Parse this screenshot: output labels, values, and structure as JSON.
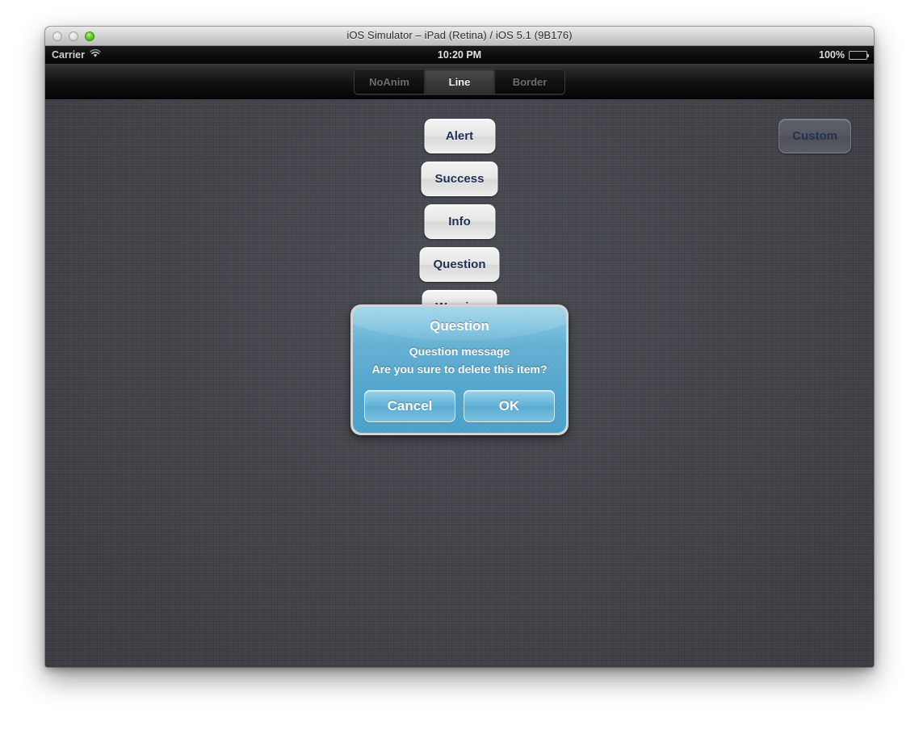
{
  "window": {
    "title": "iOS Simulator – iPad (Retina) / iOS 5.1 (9B176)",
    "traffic_lights": [
      {
        "name": "close",
        "state": "inactive"
      },
      {
        "name": "minimize",
        "state": "inactive"
      },
      {
        "name": "zoom",
        "state": "active",
        "color": "#5bc326"
      }
    ]
  },
  "status_bar": {
    "carrier": "Carrier",
    "wifi_icon": "wifi-icon",
    "time": "10:20 PM",
    "battery_percent": "100%",
    "battery_icon": "battery-full-icon"
  },
  "navbar": {
    "segmented_control": {
      "name": "animation-style-segmented-control",
      "segments": [
        {
          "label": "NoAnim",
          "selected": false
        },
        {
          "label": "Line",
          "selected": true
        },
        {
          "label": "Border",
          "selected": false
        }
      ],
      "selected_value": "Line"
    }
  },
  "content": {
    "stack_buttons": [
      {
        "label": "Alert"
      },
      {
        "label": "Success"
      },
      {
        "label": "Info"
      },
      {
        "label": "Question"
      },
      {
        "label": "Warning"
      }
    ],
    "custom_button": {
      "label": "Custom"
    }
  },
  "dialog": {
    "name": "question-alert-dialog",
    "title": "Question",
    "message_line1": "Question message",
    "message_line2": "Are you sure to delete this item?",
    "buttons": [
      {
        "label": "Cancel",
        "role": "cancel"
      },
      {
        "label": "OK",
        "role": "confirm"
      }
    ],
    "accent_color": "#59a9ce"
  }
}
